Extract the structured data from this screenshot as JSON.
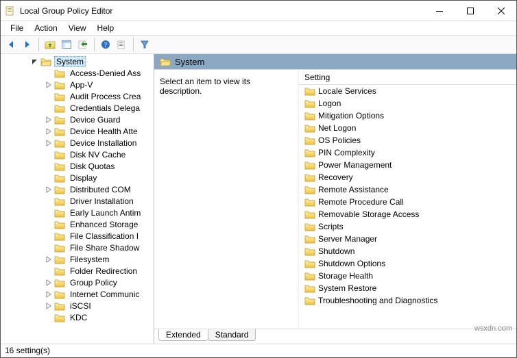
{
  "window": {
    "title": "Local Group Policy Editor"
  },
  "menu": {
    "file": "File",
    "action": "Action",
    "view": "View",
    "help": "Help"
  },
  "tree": {
    "root": "System",
    "items": [
      "Access-Denied Ass",
      "App-V",
      "Audit Process Crea",
      "Credentials Delega",
      "Device Guard",
      "Device Health Atte",
      "Device Installation",
      "Disk NV Cache",
      "Disk Quotas",
      "Display",
      "Distributed COM",
      "Driver Installation",
      "Early Launch Antim",
      "Enhanced Storage",
      "File Classification I",
      "File Share Shadow",
      "Filesystem",
      "Folder Redirection",
      "Group Policy",
      "Internet Communic",
      "iSCSI",
      "KDC"
    ],
    "expandable": [
      1,
      4,
      5,
      6,
      10,
      16,
      18,
      19,
      20
    ]
  },
  "right": {
    "header": "System",
    "desc": "Select an item to view its description.",
    "col_header": "Setting",
    "items": [
      "Locale Services",
      "Logon",
      "Mitigation Options",
      "Net Logon",
      "OS Policies",
      "PIN Complexity",
      "Power Management",
      "Recovery",
      "Remote Assistance",
      "Remote Procedure Call",
      "Removable Storage Access",
      "Scripts",
      "Server Manager",
      "Shutdown",
      "Shutdown Options",
      "Storage Health",
      "System Restore",
      "Troubleshooting and Diagnostics"
    ]
  },
  "tabs": {
    "extended": "Extended",
    "standard": "Standard"
  },
  "status": "16 setting(s)",
  "watermark": "wsxdn.com"
}
